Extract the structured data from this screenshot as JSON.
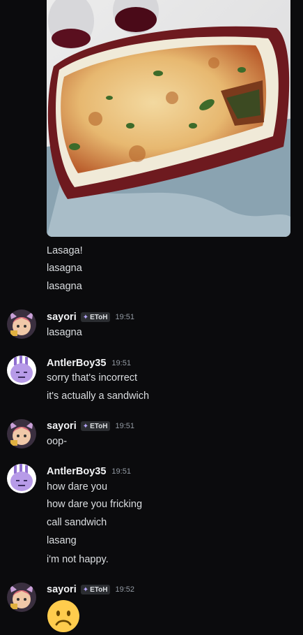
{
  "attachment": {
    "alt_icon": "lasagna-photo"
  },
  "pre_messages": [
    "Lasaga!",
    "lasagna",
    "lasagna"
  ],
  "groups": [
    {
      "author": "sayori",
      "tag": "EToH",
      "time": "19:51",
      "lines": [
        "lasagna"
      ]
    },
    {
      "author": "AntlerBoy35",
      "time": "19:51",
      "lines": [
        "sorry that's incorrect",
        "it's actually a sandwich"
      ]
    },
    {
      "author": "sayori",
      "tag": "EToH",
      "time": "19:51",
      "lines": [
        "oop-"
      ]
    },
    {
      "author": "AntlerBoy35",
      "time": "19:51",
      "lines": [
        "how dare you",
        "how dare you fricking",
        "call sandwich",
        "lasang",
        "i'm not happy."
      ]
    },
    {
      "author": "sayori",
      "tag": "EToH",
      "time": "19:52",
      "emoji": "frowning-face"
    }
  ],
  "colors": {
    "background": "#0b0b0d",
    "text": "#dbdee1",
    "timestamp": "#949ba4",
    "tag_bg": "#2b2d31"
  }
}
